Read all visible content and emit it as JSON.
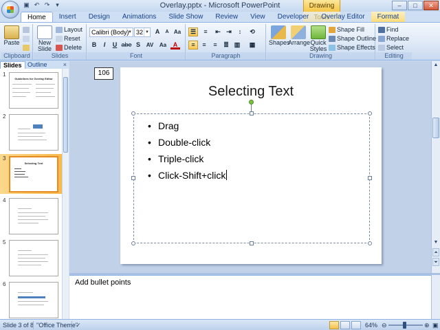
{
  "window": {
    "title": "Overlay.pptx - Microsoft PowerPoint",
    "contextual_header": "Drawing Tools",
    "controls": {
      "minimize": "–",
      "maximize": "□",
      "close": "✕"
    }
  },
  "tabs": [
    "Home",
    "Insert",
    "Design",
    "Animations",
    "Slide Show",
    "Review",
    "View",
    "Developer",
    "Overlay Editor",
    "Format"
  ],
  "ribbon": {
    "clipboard": {
      "label": "Clipboard",
      "paste": "Paste"
    },
    "slides": {
      "label": "Slides",
      "new_slide_line1": "New",
      "new_slide_line2": "Slide",
      "layout": "Layout",
      "reset": "Reset",
      "delete": "Delete"
    },
    "font": {
      "label": "Font",
      "font_name": "Calibri (Body)",
      "font_size": "32",
      "grow": "A",
      "shrink": "A",
      "clear": "Aa",
      "bold": "B",
      "italic": "I",
      "underline": "U",
      "strike": "abe",
      "shadow": "S",
      "spacing": "AV",
      "case": "Aa",
      "color": "A"
    },
    "paragraph": {
      "label": "Paragraph"
    },
    "drawing": {
      "label": "Drawing",
      "shapes": "Shapes",
      "arrange": "Arrange",
      "quick_styles_line1": "Quick",
      "quick_styles_line2": "Styles",
      "shape_fill": "Shape Fill",
      "shape_outline": "Shape Outline",
      "shape_effects": "Shape Effects"
    },
    "editing": {
      "label": "Editing",
      "find": "Find",
      "replace": "Replace",
      "select": "Select"
    }
  },
  "left_panel": {
    "tab_slides": "Slides",
    "tab_outline": "Outline",
    "close": "×",
    "slides": [
      {
        "num": "1",
        "title": "Guidelines for Overlay Editor"
      },
      {
        "num": "2",
        "title": ""
      },
      {
        "num": "3",
        "title": "Selecting Text"
      },
      {
        "num": "4",
        "title": ""
      },
      {
        "num": "5",
        "title": ""
      },
      {
        "num": "6",
        "title": ""
      }
    ]
  },
  "main": {
    "slide_number_box": "106",
    "slide_title": "Selecting Text",
    "bullets": [
      "Drag",
      "Double-click",
      "Triple-click",
      "Click-Shift+click"
    ]
  },
  "notes": {
    "text": "Add bullet points"
  },
  "status": {
    "slide_info": "Slide 3 of 8",
    "theme": "\"Office Theme\"",
    "zoom": "64%"
  },
  "colors": {
    "accent": "#f7b94c",
    "ribbon": "#dfe9f6",
    "frame": "#8db2e3"
  }
}
